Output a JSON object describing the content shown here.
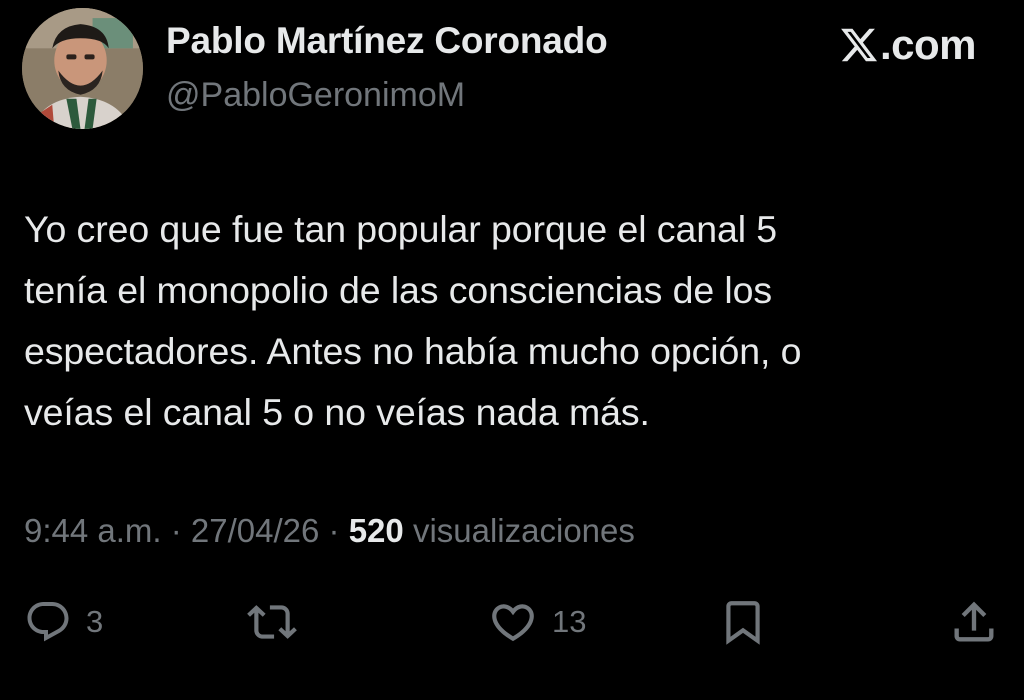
{
  "header": {
    "display_name": "Pablo Martínez Coronado",
    "handle": "@PabloGeronimoM",
    "site_label": ".com"
  },
  "tweet": {
    "text": "Yo creo que fue tan popular porque el canal 5\ntenía el monopolio de las consciencias de los\nespectadores. Antes no había mucho opción, o\nveías el canal 5 o no veías nada más."
  },
  "meta": {
    "time": "9:44 a.m.",
    "separator": " · ",
    "date": "27/04/26",
    "views_count": "520",
    "views_label": "visualizaciones"
  },
  "actions": {
    "reply": {
      "icon": "reply-icon",
      "count": "3"
    },
    "repost": {
      "icon": "repost-icon",
      "count": ""
    },
    "like": {
      "icon": "heart-icon",
      "count": "13"
    },
    "bookmark": {
      "icon": "bookmark-icon"
    },
    "share": {
      "icon": "share-icon"
    }
  },
  "colors": {
    "background": "#000000",
    "primary_text": "#e7e9ea",
    "secondary_text": "#71767b"
  }
}
